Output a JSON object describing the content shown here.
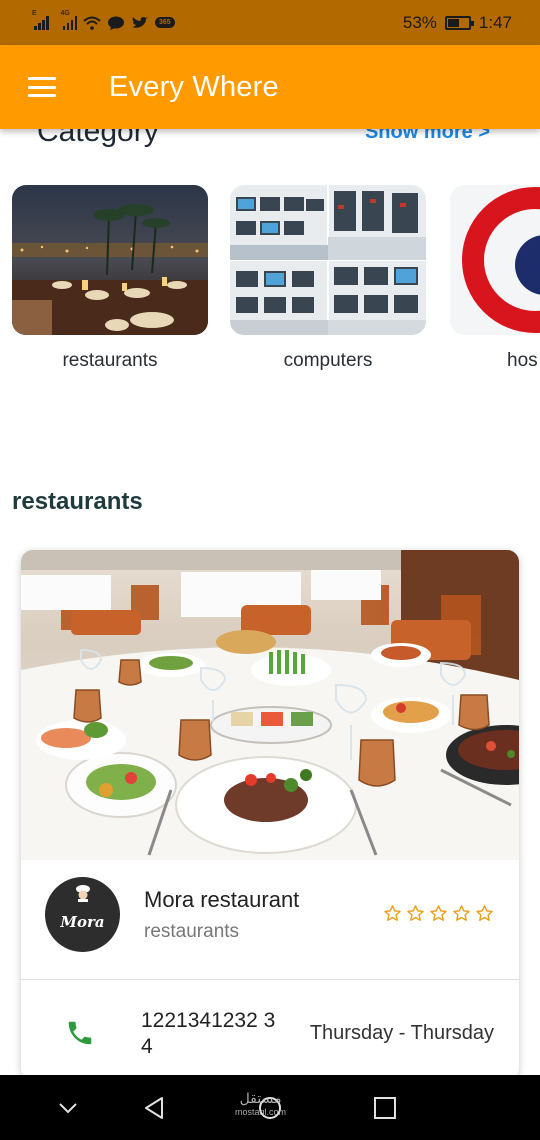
{
  "status_bar": {
    "signal_1_label": "E",
    "signal_2_label": "4G",
    "vpn_badge": "365",
    "battery_percent": "53%",
    "battery_level": 0.53,
    "time": "1:47"
  },
  "app_bar": {
    "title": "Every Where",
    "menu_icon": "hamburger-menu-icon",
    "background": "#ff9a00"
  },
  "category_section": {
    "title": "Category",
    "show_more": "Show more >",
    "items": [
      {
        "label": "restaurants"
      },
      {
        "label": "computers"
      },
      {
        "label": "hos"
      }
    ]
  },
  "restaurants_section": {
    "title": "restaurants",
    "card": {
      "logo_text": "Mora",
      "name": "Mora restaurant",
      "category": "restaurants",
      "rating": 0,
      "rating_max": 5,
      "phone": "1221341232 34",
      "days": "Thursday - Thursday",
      "star_color": "#e8a01c",
      "phone_icon_color": "#2e9a3e"
    }
  },
  "nav_bar": {
    "buttons": [
      "chevron-down-icon",
      "back-triangle-icon",
      "home-circle-icon",
      "recents-square-icon"
    ],
    "watermark_top": "مستقل",
    "watermark_bottom": "mostaql.com"
  }
}
